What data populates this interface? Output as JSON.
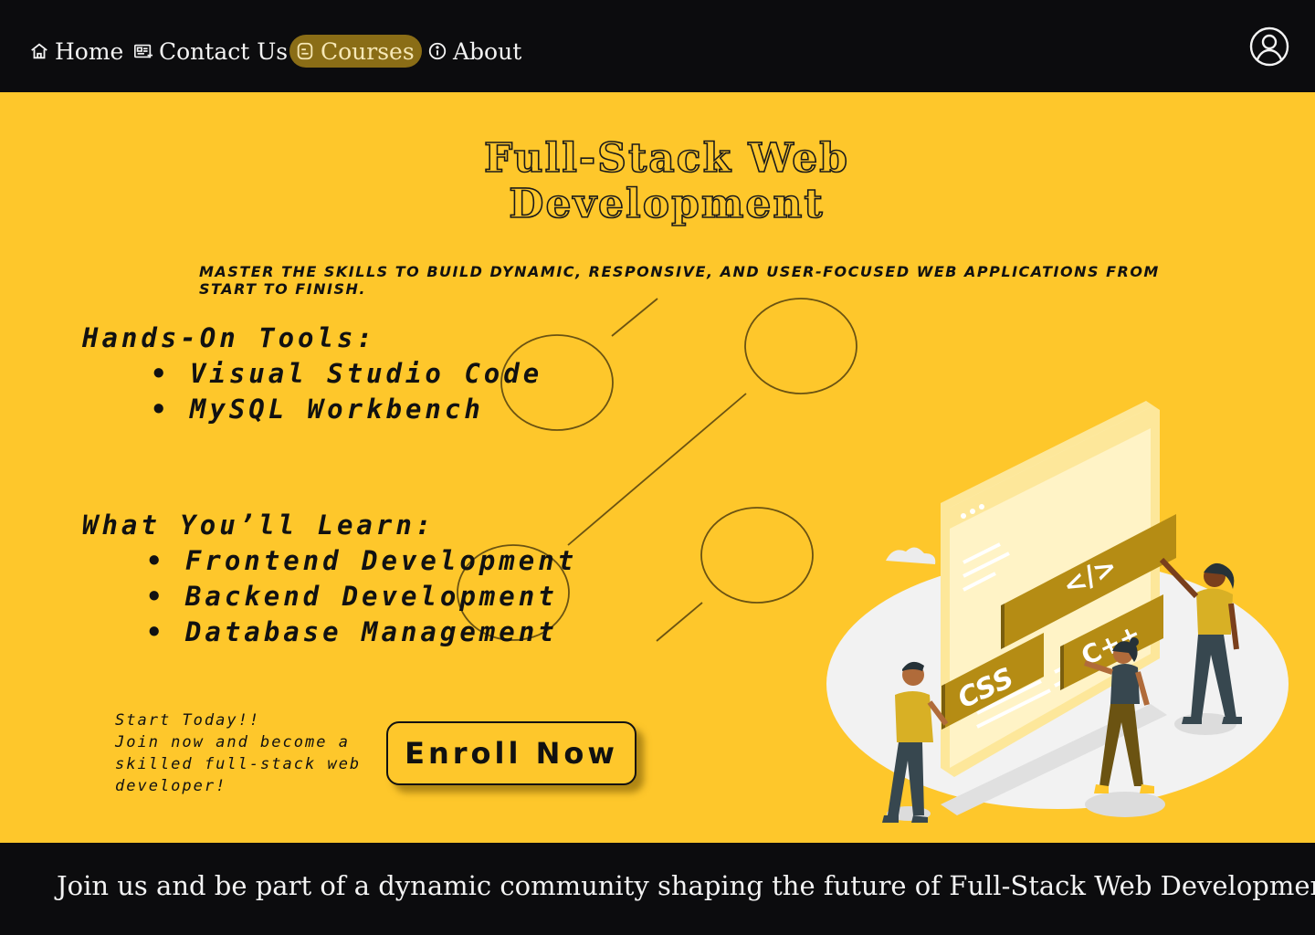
{
  "nav": {
    "items": [
      {
        "label": "Home",
        "icon": "home-icon"
      },
      {
        "label": "Contact Us",
        "icon": "contact-card-icon"
      },
      {
        "label": "Courses",
        "icon": "book-icon",
        "active": true
      },
      {
        "label": "About",
        "icon": "info-icon"
      }
    ],
    "user_icon": "user-icon",
    "active_color": "#8a6d16"
  },
  "hero": {
    "title_line1": "Full-Stack Web",
    "title_line2": "Development",
    "subtitle": "Master the skills to build dynamic, responsive, and user-focused web applications from start to finish.",
    "tools": {
      "heading": "Hands-On Tools:",
      "items": [
        "• Visual Studio Code",
        "• MySQL Workbench"
      ]
    },
    "learn": {
      "heading": "What You’ll Learn:",
      "items": [
        "• Frontend Development",
        "• Backend Development",
        "• Database Management"
      ]
    },
    "cta": {
      "line1": "Start Today!!",
      "line2": "Join now and become a",
      "line3": "skilled full-stack web",
      "line4": "developer!",
      "button_label": "Enroll Now"
    },
    "illustration": {
      "code_tag": "</>",
      "css_label": "CSS",
      "cpp_label": "C++"
    },
    "background_color": "#fec72b"
  },
  "footer": {
    "text": "Join us and be part of a dynamic community shaping the future of Full-Stack Web Development!"
  }
}
